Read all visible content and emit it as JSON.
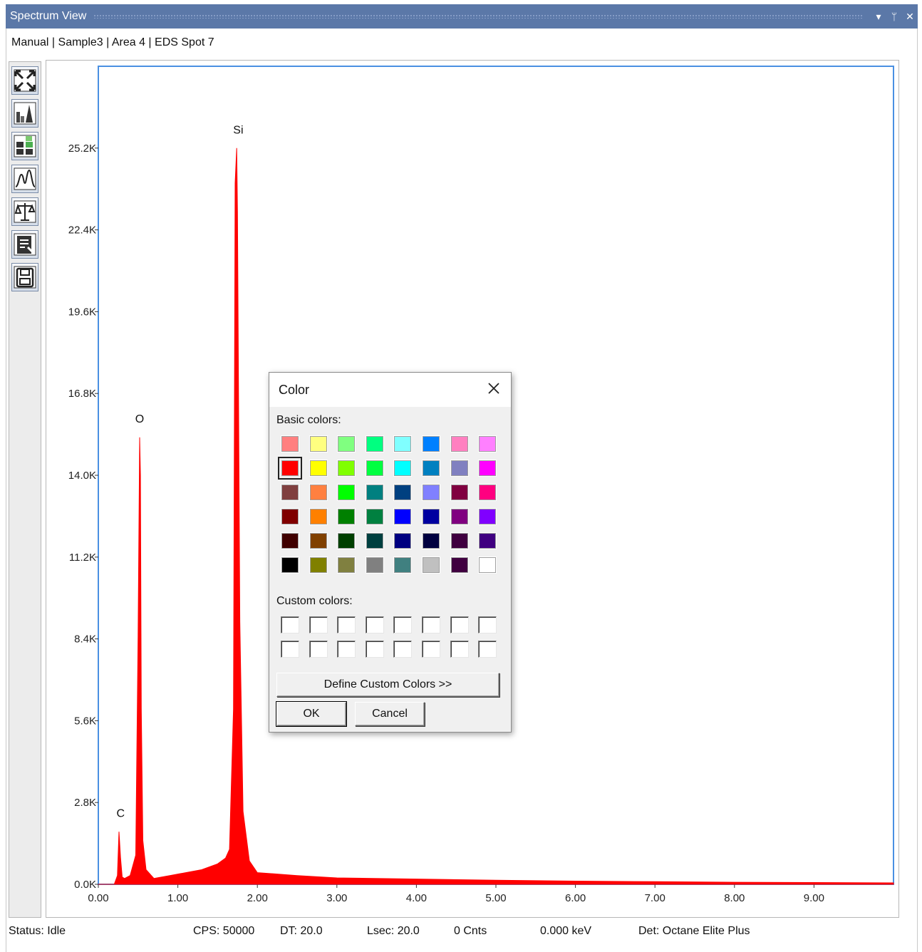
{
  "window": {
    "title": "Spectrum View",
    "buttons": [
      "▾",
      "ᛘ",
      "✕"
    ]
  },
  "breadcrumb": "Manual | Sample3 | Area 4 | EDS Spot 7",
  "toolbar": {
    "tools": [
      "zoom-fit-icon",
      "histogram-icon",
      "grid-blocks-icon",
      "peak-icon",
      "scale-balance-icon",
      "report-icon",
      "save-icon"
    ]
  },
  "chart_data": {
    "type": "line",
    "title": "",
    "xlabel": "",
    "ylabel": "",
    "xlim": [
      0,
      10
    ],
    "ylim": [
      0,
      28000
    ],
    "x_ticks": [
      "0.00",
      "1.00",
      "2.00",
      "3.00",
      "4.00",
      "5.00",
      "6.00",
      "7.00",
      "8.00",
      "9.00"
    ],
    "y_ticks": [
      "0.0K",
      "2.8K",
      "5.6K",
      "8.4K",
      "11.2K",
      "14.0K",
      "16.8K",
      "19.6K",
      "22.4K",
      "25.2K"
    ],
    "series_color": "#ff0000",
    "x": [
      0.0,
      0.1,
      0.2,
      0.24,
      0.26,
      0.28,
      0.3,
      0.33,
      0.4,
      0.47,
      0.5,
      0.52,
      0.53,
      0.54,
      0.56,
      0.6,
      0.7,
      0.9,
      1.1,
      1.3,
      1.5,
      1.6,
      1.65,
      1.7,
      1.72,
      1.74,
      1.75,
      1.78,
      1.82,
      1.9,
      2.0,
      2.5,
      3.0,
      4.0,
      5.0,
      6.0,
      7.0,
      8.0,
      9.0,
      10.0
    ],
    "y": [
      0,
      0,
      0,
      300,
      1800,
      900,
      250,
      200,
      300,
      1000,
      8500,
      15300,
      14000,
      6000,
      1500,
      500,
      200,
      300,
      400,
      500,
      700,
      900,
      1200,
      6000,
      24000,
      25200,
      23000,
      9000,
      2500,
      800,
      400,
      300,
      220,
      180,
      140,
      110,
      90,
      70,
      60,
      50
    ],
    "annotations": [
      {
        "label": "C",
        "x": 0.28,
        "y": 2300
      },
      {
        "label": "O",
        "x": 0.52,
        "y": 15800
      },
      {
        "label": "Si",
        "x": 1.76,
        "y": 25700
      }
    ]
  },
  "status": {
    "state": "Status: Idle",
    "cps": "CPS: 50000",
    "dt": "DT: 20.0",
    "lsec": "Lsec: 20.0",
    "counts": "0 Cnts",
    "energy": "0.000 keV",
    "detector": "Det: Octane Elite Plus"
  },
  "color_dialog": {
    "title": "Color",
    "basic_label": "Basic colors:",
    "custom_label": "Custom colors:",
    "define_button": "Define Custom Colors >>",
    "ok_button": "OK",
    "cancel_button": "Cancel",
    "selected_index": 8,
    "basic_colors": [
      "#ff8080",
      "#ffff80",
      "#80ff80",
      "#00ff80",
      "#80ffff",
      "#0080ff",
      "#ff80c0",
      "#ff80ff",
      "#ff0000",
      "#ffff00",
      "#80ff00",
      "#00ff40",
      "#00ffff",
      "#0080c0",
      "#8080c0",
      "#ff00ff",
      "#804040",
      "#ff8040",
      "#00ff00",
      "#008080",
      "#004080",
      "#8080ff",
      "#800040",
      "#ff0080",
      "#800000",
      "#ff8000",
      "#008000",
      "#008040",
      "#0000ff",
      "#0000a0",
      "#800080",
      "#8000ff",
      "#400000",
      "#804000",
      "#004000",
      "#004040",
      "#000080",
      "#000040",
      "#400040",
      "#400080",
      "#000000",
      "#808000",
      "#808040",
      "#808080",
      "#408080",
      "#c0c0c0",
      "#400040",
      "#ffffff"
    ],
    "custom_count": 16
  }
}
